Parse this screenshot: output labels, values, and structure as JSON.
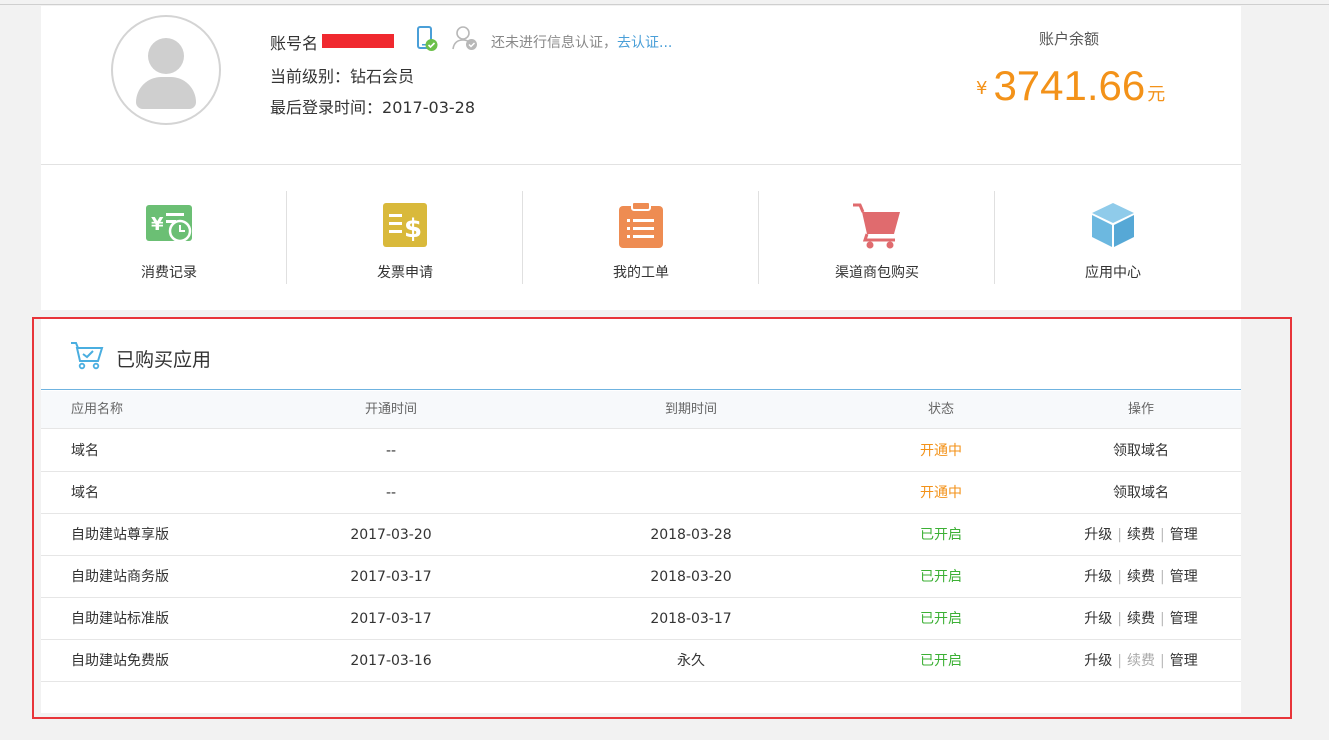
{
  "profile": {
    "account_label": "账号名",
    "level_label": "当前级别：",
    "level_value": "钻石会员",
    "login_label": "最后登录时间：",
    "login_value": "2017-03-28",
    "verify_text": "还未进行信息认证，",
    "verify_link": "去认证..."
  },
  "balance": {
    "label": "账户余额",
    "currency": "¥",
    "amount": "3741.66",
    "unit": "元"
  },
  "quick_links": [
    {
      "label": "消费记录",
      "icon": "consumption-record-icon",
      "color": "#6bbf74"
    },
    {
      "label": "发票申请",
      "icon": "invoice-icon",
      "color": "#d9b93b"
    },
    {
      "label": "我的工单",
      "icon": "clipboard-icon",
      "color": "#ee8c52"
    },
    {
      "label": "渠道商包购买",
      "icon": "shopping-cart-icon",
      "color": "#e06b6e"
    },
    {
      "label": "应用中心",
      "icon": "cube-icon",
      "color": "#6cb8e0"
    }
  ],
  "apps": {
    "title": "已购买应用",
    "headers": {
      "name": "应用名称",
      "open": "开通时间",
      "expire": "到期时间",
      "status": "状态",
      "op": "操作"
    },
    "rows": [
      {
        "name": "域名",
        "open": "--",
        "expire": "",
        "status": "开通中",
        "ops": [
          "领取域名"
        ]
      },
      {
        "name": "域名",
        "open": "--",
        "expire": "",
        "status": "开通中",
        "ops": [
          "领取域名"
        ]
      },
      {
        "name": "自助建站尊享版",
        "open": "2017-03-20",
        "expire": "2018-03-28",
        "status": "已开启",
        "ops": [
          "升级",
          "续费",
          "管理"
        ]
      },
      {
        "name": "自助建站商务版",
        "open": "2017-03-17",
        "expire": "2018-03-20",
        "status": "已开启",
        "ops": [
          "升级",
          "续费",
          "管理"
        ]
      },
      {
        "name": "自助建站标准版",
        "open": "2017-03-17",
        "expire": "2018-03-17",
        "status": "已开启",
        "ops": [
          "升级",
          "续费",
          "管理"
        ]
      },
      {
        "name": "自助建站免费版",
        "open": "2017-03-16",
        "expire": "永久",
        "status": "已开启",
        "ops": [
          "升级",
          "续费",
          "管理"
        ]
      }
    ]
  },
  "colors": {
    "accent_orange": "#f39219",
    "status_green": "#3cb035",
    "link_blue": "#4a9fd8",
    "highlight_red": "#e8353a"
  }
}
